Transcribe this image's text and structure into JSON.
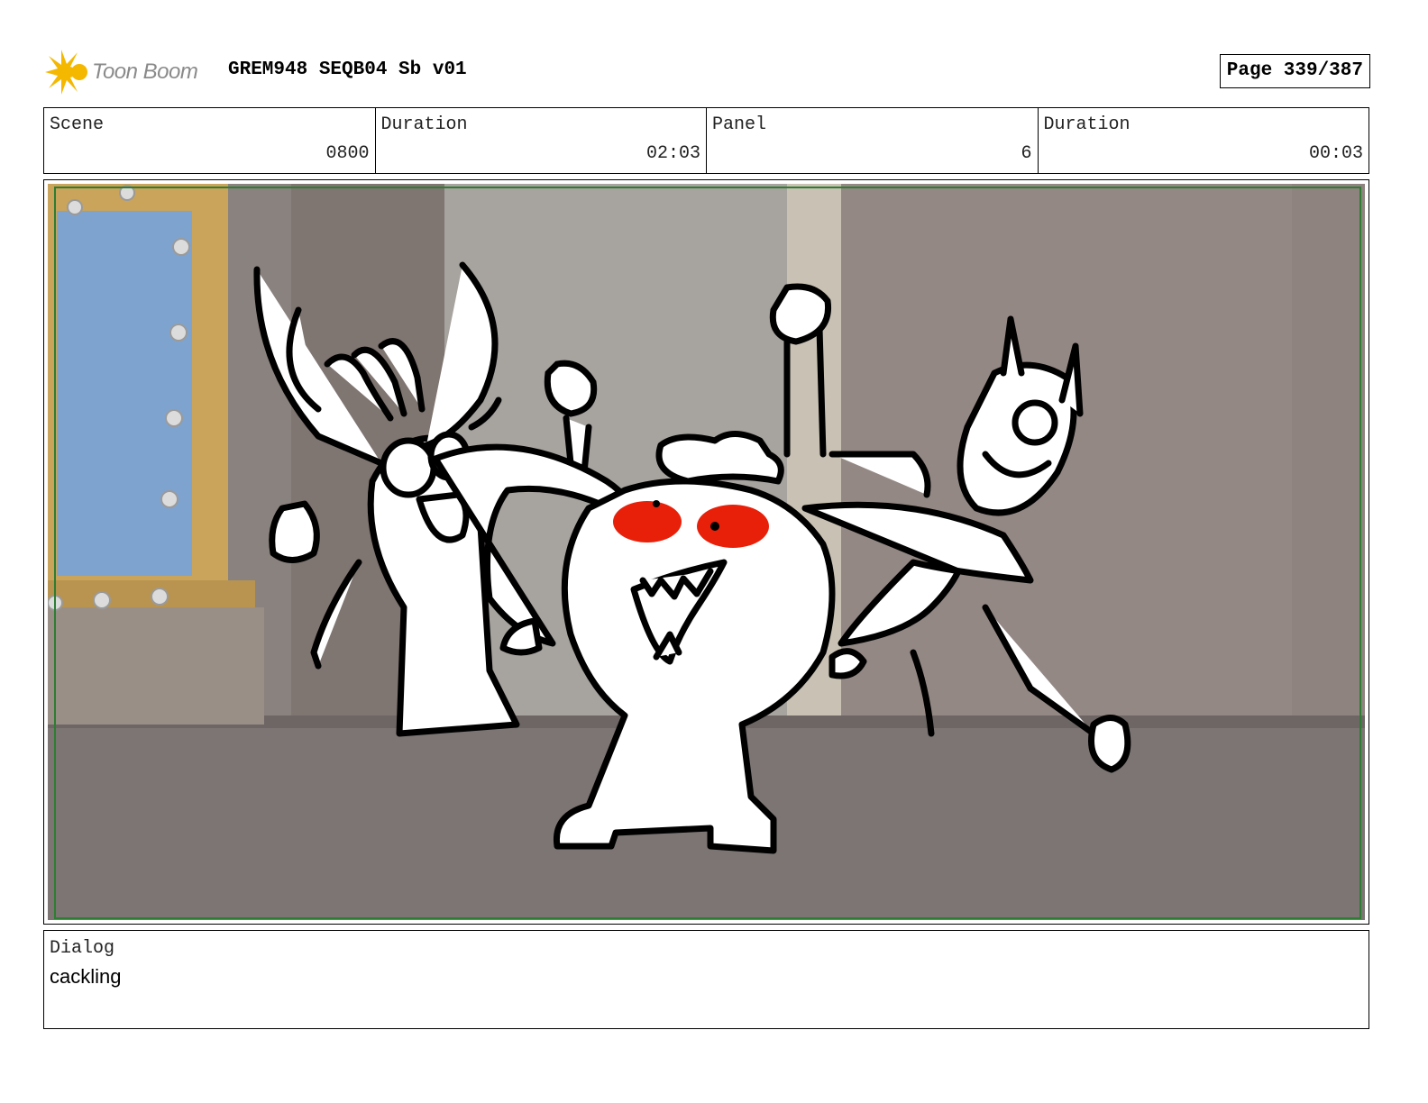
{
  "header": {
    "logo_text": "Toon Boom",
    "title": "GREM948 SEQB04 Sb v01",
    "page": "Page 339/387"
  },
  "info": {
    "scene_label": "Scene",
    "scene_value": "0800",
    "duration_label": "Duration",
    "duration_value": "02:03",
    "panel_label": "Panel",
    "panel_value": "6",
    "panel_duration_label": "Duration",
    "panel_duration_value": "00:03"
  },
  "dialog": {
    "label": "Dialog",
    "text": "cackling"
  },
  "colors": {
    "logo_accent": "#f5b800",
    "safe_frame": "#2e7d32",
    "eye_red": "#e8200a",
    "window_blue": "#7fa3cf",
    "frame_gold": "#c9a45a"
  }
}
